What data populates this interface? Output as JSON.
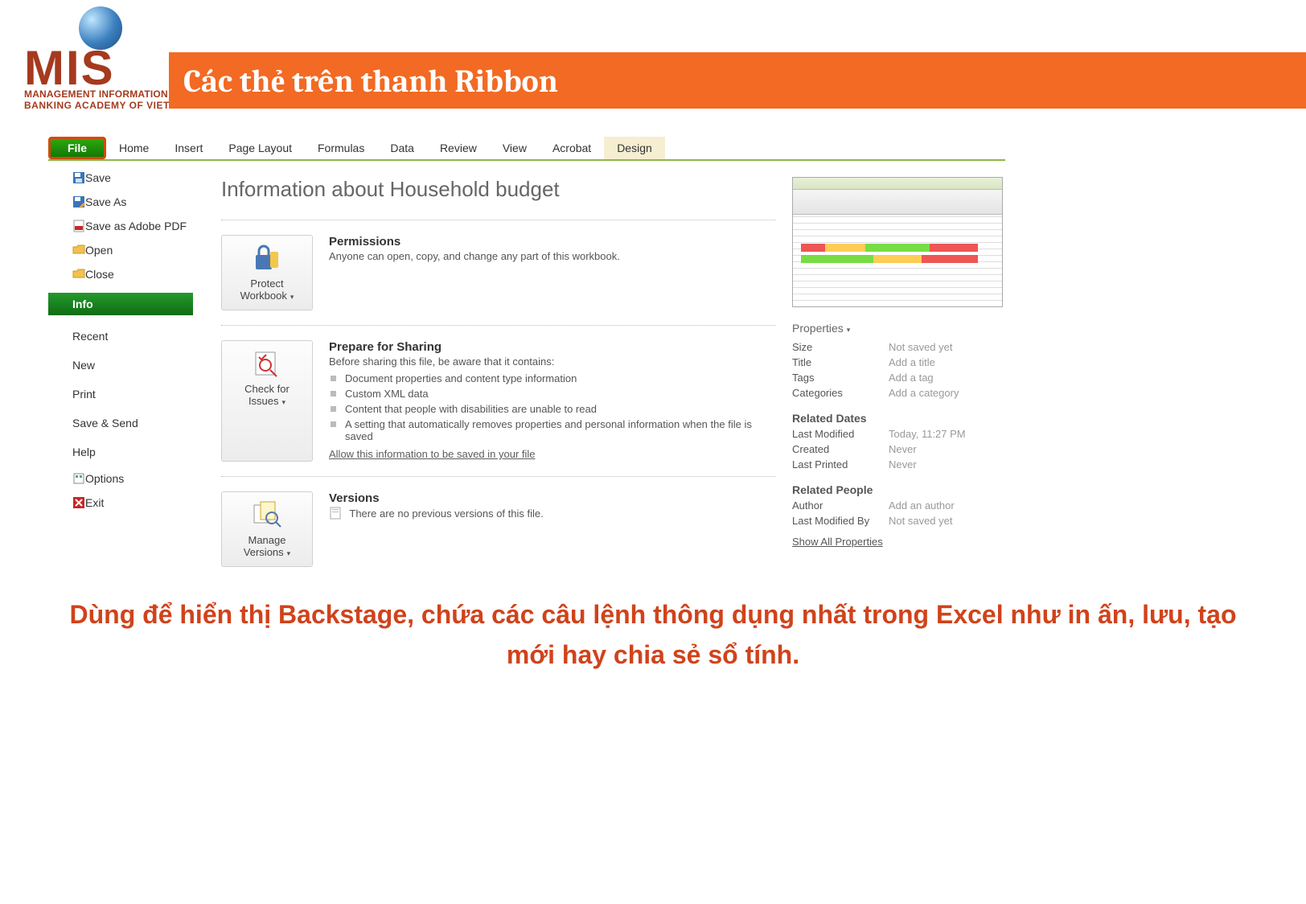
{
  "header": {
    "logo_main": "MIS",
    "logo_sub1": "MANAGEMENT INFORMATION SYSTEMS",
    "logo_sub2": "BANKING ACADEMY OF VIETNAM",
    "title": "Các thẻ trên thanh Ribbon"
  },
  "ribbon": {
    "file": "File",
    "tabs": [
      "Home",
      "Insert",
      "Page Layout",
      "Formulas",
      "Data",
      "Review",
      "View",
      "Acrobat",
      "Design"
    ]
  },
  "sidebar": {
    "items": [
      {
        "label": "Save",
        "icon": "save-icon"
      },
      {
        "label": "Save As",
        "icon": "save-as-icon"
      },
      {
        "label": "Save as Adobe PDF",
        "icon": "pdf-icon"
      },
      {
        "label": "Open",
        "icon": "folder-open-icon"
      },
      {
        "label": "Close",
        "icon": "folder-close-icon"
      }
    ],
    "active": "Info",
    "plain": [
      "Recent",
      "New",
      "Print",
      "Save & Send",
      "Help"
    ],
    "bottom": [
      {
        "label": "Options",
        "icon": "options-icon"
      },
      {
        "label": "Exit",
        "icon": "exit-icon"
      }
    ]
  },
  "main": {
    "title": "Information about Household budget",
    "perm": {
      "heading": "Permissions",
      "text": "Anyone can open, copy, and change any part of this workbook.",
      "btn": "Protect Workbook"
    },
    "share": {
      "heading": "Prepare for Sharing",
      "text": "Before sharing this file, be aware that it contains:",
      "bullets": [
        "Document properties and content type information",
        "Custom XML data",
        "Content that people with disabilities are unable to read",
        "A setting that automatically removes properties and personal information when the file is saved"
      ],
      "link": "Allow this information to be saved in your file",
      "btn": "Check for Issues"
    },
    "ver": {
      "heading": "Versions",
      "text": "There are no previous versions of this file.",
      "btn": "Manage Versions"
    }
  },
  "right": {
    "prop_label": "Properties",
    "props": [
      {
        "k": "Size",
        "v": "Not saved yet"
      },
      {
        "k": "Title",
        "v": "Add a title"
      },
      {
        "k": "Tags",
        "v": "Add a tag"
      },
      {
        "k": "Categories",
        "v": "Add a category"
      }
    ],
    "dates_label": "Related Dates",
    "dates": [
      {
        "k": "Last Modified",
        "v": "Today, 11:27 PM"
      },
      {
        "k": "Created",
        "v": "Never"
      },
      {
        "k": "Last Printed",
        "v": "Never"
      }
    ],
    "people_label": "Related People",
    "people": [
      {
        "k": "Author",
        "v": "Add an author"
      },
      {
        "k": "Last Modified By",
        "v": "Not saved yet"
      }
    ],
    "show_all": "Show All Properties"
  },
  "description": "Dùng để hiển thị Backstage, chứa các câu lệnh thông dụng nhất trong Excel như in ấn, lưu, tạo mới hay chia sẻ sổ tính."
}
